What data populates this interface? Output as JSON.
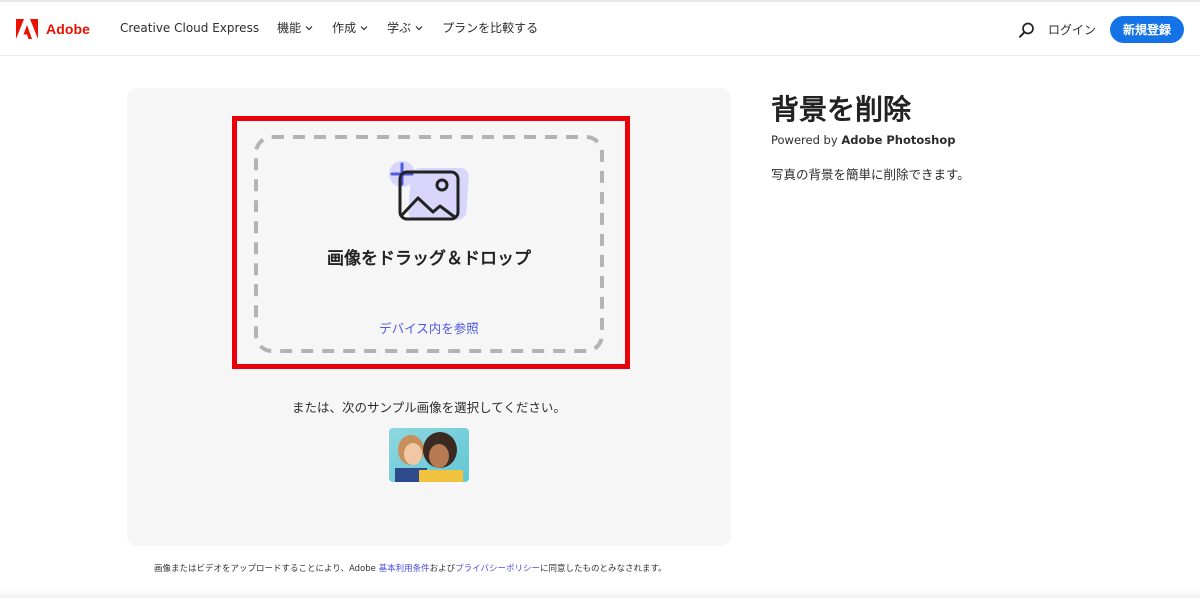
{
  "colors": {
    "brand_red": "#eb1000",
    "accent_blue": "#1473e6",
    "highlight_red": "#e8000b",
    "link_purple": "#5258e4"
  },
  "nav": {
    "brand": "Adobe",
    "product": "Creative Cloud Express",
    "menu": [
      {
        "label": "機能",
        "icon": "chevron-down-icon"
      },
      {
        "label": "作成",
        "icon": "chevron-down-icon"
      },
      {
        "label": "学ぶ",
        "icon": "chevron-down-icon"
      },
      {
        "label": "プランを比較する"
      }
    ],
    "search_icon": "search-icon",
    "login": "ログイン",
    "signup": "新規登録"
  },
  "upload": {
    "icon": "image-add-icon",
    "title": "画像をドラッグ＆ドロップ",
    "browse": "デバイス内を参照",
    "sample_prompt": "または、次のサンプル画像を選択してください。"
  },
  "terms": {
    "text1": "画像またはビデオをアップロードすることにより、Adobe ",
    "link1": "基本利用条件",
    "text2": "および",
    "link2": "プライバシーポリシー",
    "text3": "に同意したものとみなされます。"
  },
  "info": {
    "title": "背景を削除",
    "powered_prefix": "Powered by ",
    "powered_product": "Adobe Photoshop",
    "description": "写真の背景を簡単に削除できます。"
  }
}
